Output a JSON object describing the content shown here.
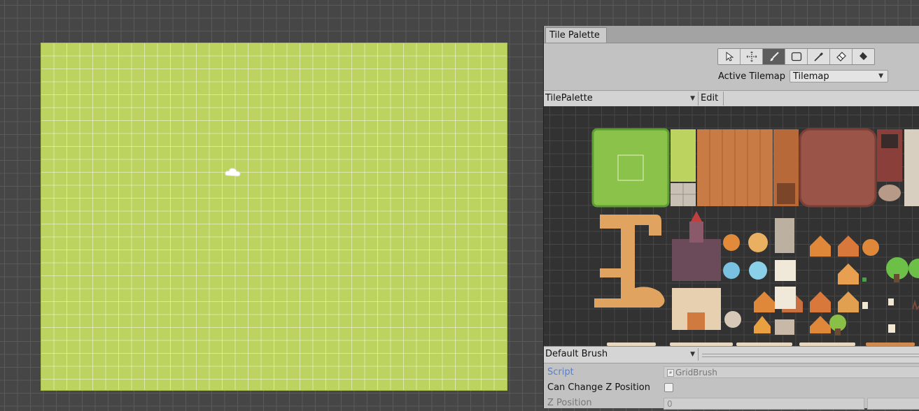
{
  "scene": {
    "tilemap_color": "#bcd35f",
    "gizmo_icon": "cloud-icon"
  },
  "palette_window": {
    "tab_label": "Tile Palette",
    "tools": [
      {
        "name": "select-tool",
        "icon": "pointer-icon"
      },
      {
        "name": "move-tool",
        "icon": "move-arrows-icon"
      },
      {
        "name": "paint-tool",
        "icon": "paintbrush-icon",
        "active": true
      },
      {
        "name": "box-fill-tool",
        "icon": "rectangle-icon"
      },
      {
        "name": "picker-tool",
        "icon": "eyedropper-icon"
      },
      {
        "name": "erase-tool",
        "icon": "eraser-icon"
      },
      {
        "name": "fill-tool",
        "icon": "paint-bucket-icon"
      }
    ],
    "active_tilemap_label": "Active Tilemap",
    "active_tilemap_value": "Tilemap",
    "palette_name": "TilePalette",
    "edit_label": "Edit"
  },
  "brush": {
    "name": "Default Brush",
    "script_label": "Script",
    "script_value": "GridBrush",
    "can_change_z_label": "Can Change Z Position",
    "can_change_z_checked": false,
    "z_position_label": "Z Position",
    "z_position_value": "0"
  }
}
